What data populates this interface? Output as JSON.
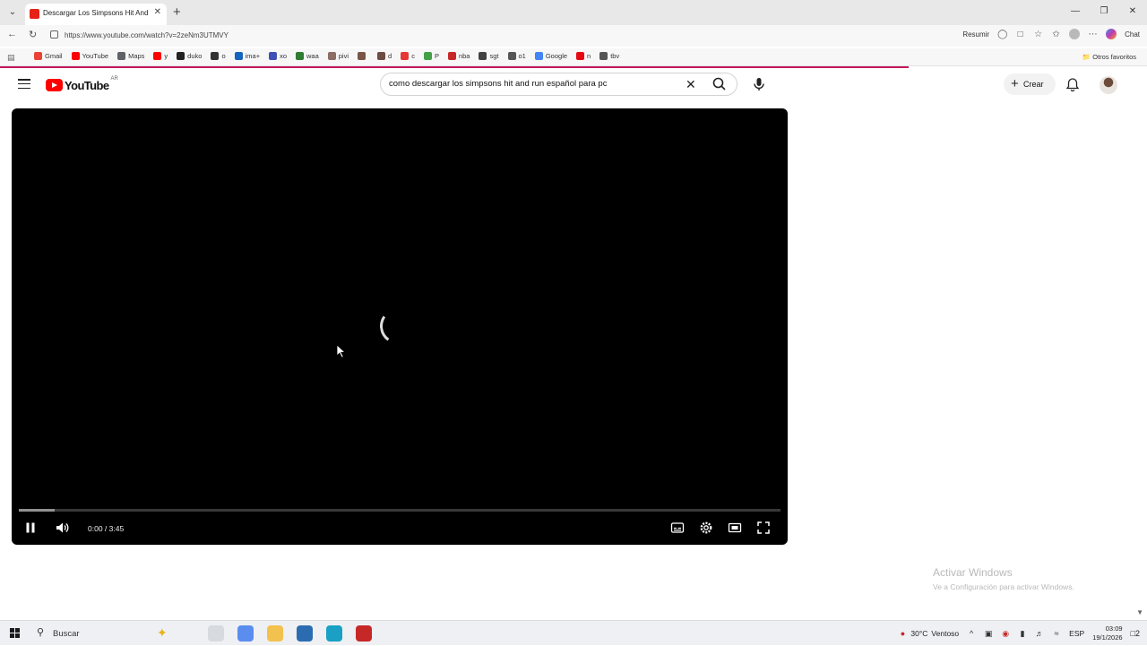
{
  "browser": {
    "tab_title": "Descargar Los Simpsons Hit And Run",
    "url": "https://www.youtube.com/watch?v=2zeNm3UTMVY",
    "resumir_label": "Resumir",
    "chat_label": "Chat",
    "bookmarks": [
      {
        "label": "Gmail",
        "color": "#ea4335"
      },
      {
        "label": "YouTube",
        "color": "#ff0000"
      },
      {
        "label": "Maps",
        "color": "#5f6368"
      },
      {
        "label": "y",
        "color": "#ff0000"
      },
      {
        "label": "duko",
        "color": "#222222"
      },
      {
        "label": "o",
        "color": "#333333"
      },
      {
        "label": "ima+",
        "color": "#1565c0"
      },
      {
        "label": "xo",
        "color": "#3f51b5"
      },
      {
        "label": "waa",
        "color": "#2e7d32"
      },
      {
        "label": "pivi",
        "color": "#8d6e63"
      },
      {
        "label": "",
        "color": "#795548"
      },
      {
        "label": "d",
        "color": "#6d4c41"
      },
      {
        "label": "c",
        "color": "#e53935"
      },
      {
        "label": "P",
        "color": "#43a047"
      },
      {
        "label": "nba",
        "color": "#c62828"
      },
      {
        "label": "sgt",
        "color": "#424242"
      },
      {
        "label": "o1",
        "color": "#555555"
      },
      {
        "label": "Google",
        "color": "#4285f4"
      },
      {
        "label": "n",
        "color": "#e50914"
      },
      {
        "label": "tbv",
        "color": "#555555"
      }
    ],
    "other_favorites": "Otros favoritos"
  },
  "youtube": {
    "logo_text": "YouTube",
    "country_code": "AR",
    "search_query": "como descargar los simpsons hit and run español para pc",
    "create_label": "Crear"
  },
  "player": {
    "time_display": "0:00 / 3:45",
    "state": "loading",
    "buffered_fraction": 0.047
  },
  "watermark": {
    "title": "Activar Windows",
    "subtitle": "Ve a Configuración para activar Windows."
  },
  "taskbar": {
    "search_placeholder": "Buscar",
    "weather_temp": "30°C",
    "weather_desc": "Ventoso",
    "language": "ESP",
    "time": "03:09",
    "date": "19/1/2026",
    "notification_count": "2",
    "apps": [
      {
        "name": "task-view",
        "color": "#d7dbe0"
      },
      {
        "name": "copilot",
        "color": "#5b8def"
      },
      {
        "name": "file-explorer",
        "color": "#f2c14e"
      },
      {
        "name": "store",
        "color": "#2b6cb0"
      },
      {
        "name": "edge",
        "color": "#19a0c4"
      },
      {
        "name": "app",
        "color": "#c62828"
      }
    ]
  }
}
